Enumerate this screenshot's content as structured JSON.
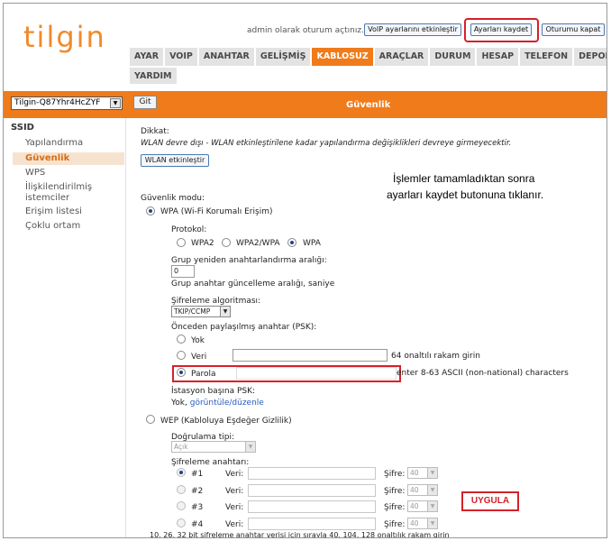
{
  "header": {
    "logo": "tilgin",
    "login_text": "admin olarak oturum açtınız.",
    "btn_voip": "VoIP ayarlarını etkinleştir",
    "btn_save": "Ayarları kaydet",
    "btn_logout": "Oturumu kapat"
  },
  "menu": {
    "row1": [
      "AYAR",
      "VOIP",
      "ANAHTAR",
      "GELİŞMİŞ",
      "KABLOSUZ",
      "ARAÇLAR",
      "DURUM",
      "HESAP",
      "TELEFON",
      "DEPOLAMA"
    ],
    "row2": [
      "YARDIM"
    ],
    "active": "KABLOSUZ"
  },
  "ssid_bar": {
    "selected": "Tilgin-Q87Yhr4HcZYF",
    "go_label": "Git",
    "title": "Güvenlik"
  },
  "sidebar": {
    "title": "SSID",
    "items": [
      "Yapılandırma",
      "Güvenlik",
      "WPS",
      "İlişkilendirilmiş istemciler",
      "Erişim listesi",
      "Çoklu ortam"
    ],
    "active": "Güvenlik"
  },
  "main": {
    "warning_title": "Dikkat:",
    "warning_text": "WLAN devre dışı - WLAN etkinleştirilene kadar yapılandırma değişiklikleri devreye girmeyecektir.",
    "wlan_btn": "WLAN etkinleştir",
    "annotation_line1": "İşlemler tamamladıktan sonra",
    "annotation_line2": "ayarları kaydet butonuna tıklanır.",
    "security_mode_label": "Güvenlik modu:",
    "wpa_label": "WPA (Wi-Fi Korumalı Erişim)",
    "protocol_label": "Protokol:",
    "protocol_options": [
      "WPA2",
      "WPA2/WPA",
      "WPA"
    ],
    "protocol_selected": "WPA",
    "rekey_label": "Grup yeniden anahtarlandırma aralığı:",
    "rekey_value": "0",
    "rekey_hint": "Grup anahtar güncelleme aralığı, saniye",
    "cipher_label": "Şifreleme algoritması:",
    "cipher_value": "TKIP/CCMP",
    "psk_label": "Önceden paylaşılmış anahtar (PSK):",
    "psk_none": "Yok",
    "psk_hex": "Veri",
    "psk_hex_hint": "64 onaltılı rakam girin",
    "psk_pass": "Parola",
    "psk_pass_hint": "enter 8-63 ASCII (non-national) characters",
    "station_psk_label": "İstasyon başına PSK:",
    "station_psk_value": "Yok,",
    "station_psk_link": "görüntüle/düzenle",
    "wep_label": "WEP (Kabloluya Eşdeğer Gizlilik)",
    "auth_label": "Doğrulama tipi:",
    "auth_value": "Açık",
    "keys_label": "Şifreleme anahtarı:",
    "keys": [
      {
        "id": "#1",
        "data_label": "Veri:",
        "cipher_label": "Şifre:",
        "cipher_value": "40"
      },
      {
        "id": "#2",
        "data_label": "Veri:",
        "cipher_label": "Şifre:",
        "cipher_value": "40"
      },
      {
        "id": "#3",
        "data_label": "Veri:",
        "cipher_label": "Şifre:",
        "cipher_value": "40"
      },
      {
        "id": "#4",
        "data_label": "Veri:",
        "cipher_label": "Şifre:",
        "cipher_value": "40"
      }
    ],
    "footer_hint": "10, 26, 32 bit şifreleme anahtar verisi için sırayla 40, 104, 128 onaltılık rakam girin",
    "apply_label": "UYGULA"
  },
  "colors": {
    "accent": "#f07b1b",
    "highlight": "#d6202a",
    "link": "#2a5bbf"
  }
}
